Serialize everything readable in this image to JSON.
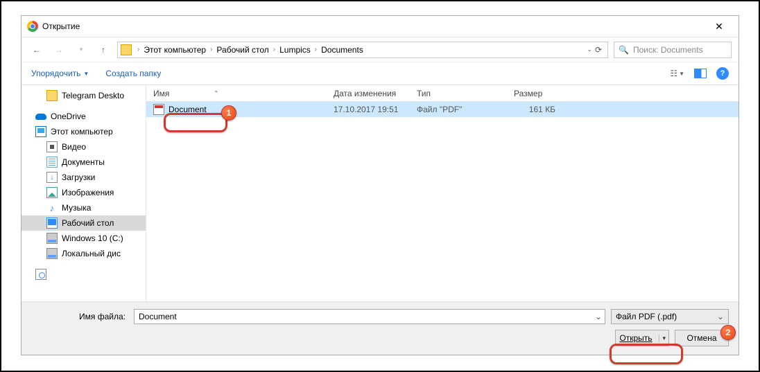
{
  "title": "Открытие",
  "breadcrumb": [
    "Этот компьютер",
    "Рабочий стол",
    "Lumpics",
    "Documents"
  ],
  "search": {
    "placeholder": "Поиск: Documents"
  },
  "toolbar": {
    "organize": "Упорядочить",
    "newfolder": "Создать папку"
  },
  "sidebar": [
    {
      "label": "Telegram Deskto",
      "icon": "folder",
      "indent": true
    },
    {
      "label": "OneDrive",
      "icon": "onedrive"
    },
    {
      "label": "Этот компьютер",
      "icon": "pc"
    },
    {
      "label": "Видео",
      "icon": "video",
      "indent": true
    },
    {
      "label": "Документы",
      "icon": "doc",
      "indent": true
    },
    {
      "label": "Загрузки",
      "icon": "down",
      "indent": true
    },
    {
      "label": "Изображения",
      "icon": "img",
      "indent": true
    },
    {
      "label": "Музыка",
      "icon": "music",
      "indent": true
    },
    {
      "label": "Рабочий стол",
      "icon": "desktop",
      "indent": true,
      "sel": true
    },
    {
      "label": "Windows 10 (C:)",
      "icon": "disk",
      "indent": true
    },
    {
      "label": "Локальный дис",
      "icon": "disk",
      "indent": true
    },
    {
      "label": "",
      "icon": "net"
    }
  ],
  "columns": {
    "name": "Имя",
    "date": "Дата изменения",
    "type": "Тип",
    "size": "Размер"
  },
  "files": [
    {
      "name": "Document",
      "date": "17.10.2017 19:51",
      "type": "Файл \"PDF\"",
      "size": "161 КБ",
      "sel": true
    }
  ],
  "bottom": {
    "filename_label": "Имя файла:",
    "filename_value": "Document",
    "filter": "Файл PDF (.pdf)",
    "open": "Открыть",
    "cancel": "Отмена"
  },
  "annotations": {
    "badge1": "1",
    "badge2": "2"
  }
}
